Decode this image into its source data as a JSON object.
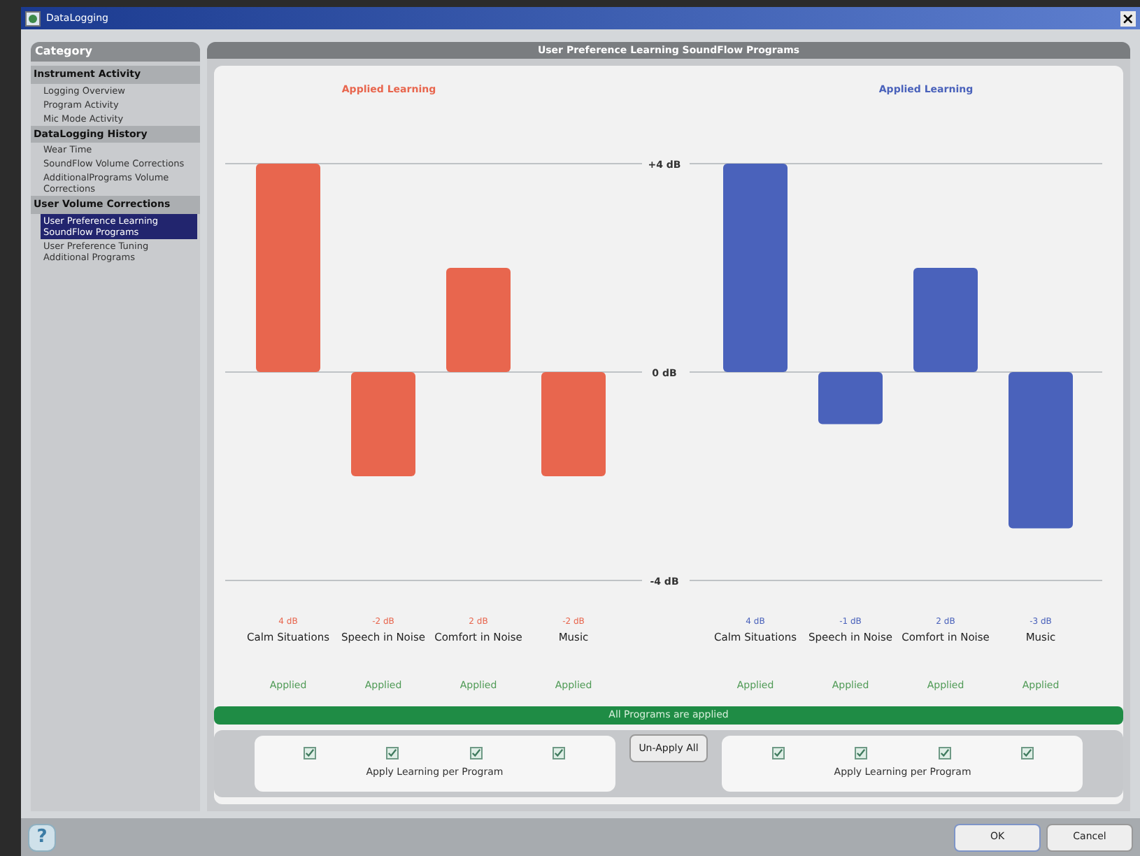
{
  "window": {
    "title": "DataLogging",
    "close": "×"
  },
  "sidebar": {
    "title": "Category",
    "sections": [
      {
        "title": "Instrument Activity",
        "items": [
          {
            "label": "Logging Overview",
            "selected": false
          },
          {
            "label": "Program Activity",
            "selected": false
          },
          {
            "label": "Mic Mode Activity",
            "selected": false
          }
        ]
      },
      {
        "title": "DataLogging History",
        "items": [
          {
            "label": "Wear Time",
            "selected": false
          },
          {
            "label": "SoundFlow Volume Corrections",
            "selected": false
          },
          {
            "label": "AdditionalPrograms Volume Corrections",
            "selected": false
          }
        ]
      },
      {
        "title": "User Volume Corrections",
        "items": [
          {
            "label": "User Preference Learning SoundFlow Programs",
            "selected": true
          },
          {
            "label": "User Preference Tuning Additional Programs",
            "selected": false
          }
        ]
      }
    ]
  },
  "main": {
    "title": "User Preference Learning SoundFlow Programs",
    "panels": [
      {
        "title": "Applied Learning",
        "color": "#e8664e",
        "chart_data": {
          "type": "bar",
          "categories": [
            "Calm Situations",
            "Speech in Noise",
            "Comfort in Noise",
            "Music"
          ],
          "values": [
            4,
            -2,
            2,
            -2
          ],
          "value_labels": [
            "4 dB",
            "-2 dB",
            "2 dB",
            "-2 dB"
          ],
          "ylim": [
            -4,
            4
          ],
          "yticks": [
            {
              "value": 4,
              "label": "+4 dB"
            },
            {
              "value": 0,
              "label": "0 dB"
            },
            {
              "value": -4,
              "label": "-4 dB"
            }
          ]
        },
        "statuses": [
          "Applied",
          "Applied",
          "Applied",
          "Applied"
        ],
        "checkboxes": [
          {
            "checked": true
          },
          {
            "checked": true
          },
          {
            "checked": true
          },
          {
            "checked": true
          }
        ],
        "apply_label": "Apply Learning per Program"
      },
      {
        "title": "Applied Learning",
        "color": "#4a62bb",
        "chart_data": {
          "type": "bar",
          "categories": [
            "Calm Situations",
            "Speech in Noise",
            "Comfort in Noise",
            "Music"
          ],
          "values": [
            4,
            -1,
            2,
            -3
          ],
          "value_labels": [
            "4 dB",
            "-1 dB",
            "2 dB",
            "-3 dB"
          ],
          "ylim": [
            -4,
            4
          ]
        },
        "statuses": [
          "Applied",
          "Applied",
          "Applied",
          "Applied"
        ],
        "checkboxes": [
          {
            "checked": true
          },
          {
            "checked": true
          },
          {
            "checked": true
          },
          {
            "checked": true
          }
        ],
        "apply_label": "Apply Learning per Program"
      }
    ],
    "status_banner": "All Programs are applied",
    "unapply_button": "Un-Apply All"
  },
  "footer": {
    "help": "?",
    "buttons": [
      "OK",
      "Cancel"
    ]
  }
}
